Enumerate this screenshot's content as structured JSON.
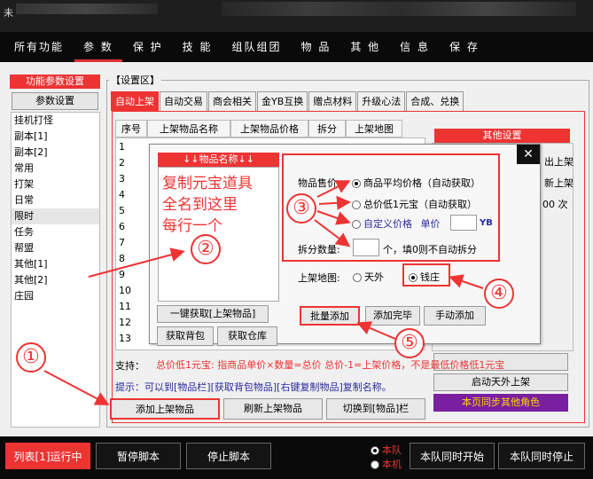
{
  "title": "未",
  "menu": [
    "所有功能",
    "参 数",
    "保 护",
    "技 能",
    "组队组团",
    "物 品",
    "其 他",
    "信 息",
    "保 存"
  ],
  "left_panel": {
    "header": "功能参数设置",
    "button": "参数设置",
    "items": [
      "挂机打怪",
      "副本[1]",
      "副本[2]",
      "常用",
      "打架",
      "日常",
      "限时",
      "任务",
      "帮盟",
      "其他[1]",
      "其他[2]",
      "庄园"
    ]
  },
  "group_title": "【设置区】",
  "tabs": [
    "自动上架",
    "自动交易",
    "商会相关",
    "金YB互换",
    "赠点材料",
    "升级心法",
    "合成、兑换"
  ],
  "table": {
    "headers": [
      "序号",
      "上架物品名称",
      "上架物品价格",
      "拆分",
      "上架地图"
    ],
    "rows": [
      "1",
      "2",
      "3",
      "4",
      "5",
      "6",
      "7",
      "8",
      "9",
      "10",
      "11",
      "12",
      "13"
    ]
  },
  "right_panel": {
    "header": "其他设置",
    "partial1": "出上架",
    "partial2": "新上架",
    "partial3": "00 次",
    "start_cross": "启动天外上架",
    "sync_other": "本页同步其他角色"
  },
  "support_label": "支持：",
  "hint_text": "提示：可以到[物品栏][获取背包物品][右键复制物品]复制名称。",
  "bottom_buttons": {
    "add": "添加上架物品",
    "refresh": "刷新上架物品",
    "switch": "切换到[物品]栏"
  },
  "popup": {
    "close": "✕",
    "item_header": "↓↓物品名称↓↓",
    "item_placeholder": "复制元宝道具\n全名到这里\n每行一个",
    "price_label": "物品售价:",
    "opt_avg": "商品平均价格",
    "opt_avg_note": "（自动获取）",
    "opt_total": "总价低1元宝",
    "opt_total_note": "（自动获取）",
    "opt_custom": "自定义价格",
    "unit_label": "单价",
    "unit_suffix": "YB",
    "split_label": "拆分数量:",
    "split_suffix": "个，填0则不自动拆分",
    "map_label": "上架地图:",
    "map_outside": "天外",
    "map_shop": "钱庄",
    "btn_fetch": "一键获取[上架物品]",
    "btn_bag": "获取背包",
    "btn_warehouse": "获取仓库",
    "btn_batch": "批量添加",
    "btn_done": "添加完毕",
    "btn_manual": "手动添加",
    "note": "总价低1元宝: 指商品单价×数量=总价 总价-1=上架价格，不是最低价格低1元宝"
  },
  "annotations": [
    "①",
    "②",
    "③",
    "④",
    "⑤"
  ],
  "status_bar": {
    "running": "列表[1]运行中",
    "pause": "暂停脚本",
    "stop": "停止脚本",
    "team": "本队",
    "self": "本机",
    "team_start": "本队同时开始",
    "team_stop": "本队同时停止"
  },
  "colors": {
    "accent": "#e33333",
    "hint": "#2a2aa0",
    "purple": "#7a1fa0"
  }
}
